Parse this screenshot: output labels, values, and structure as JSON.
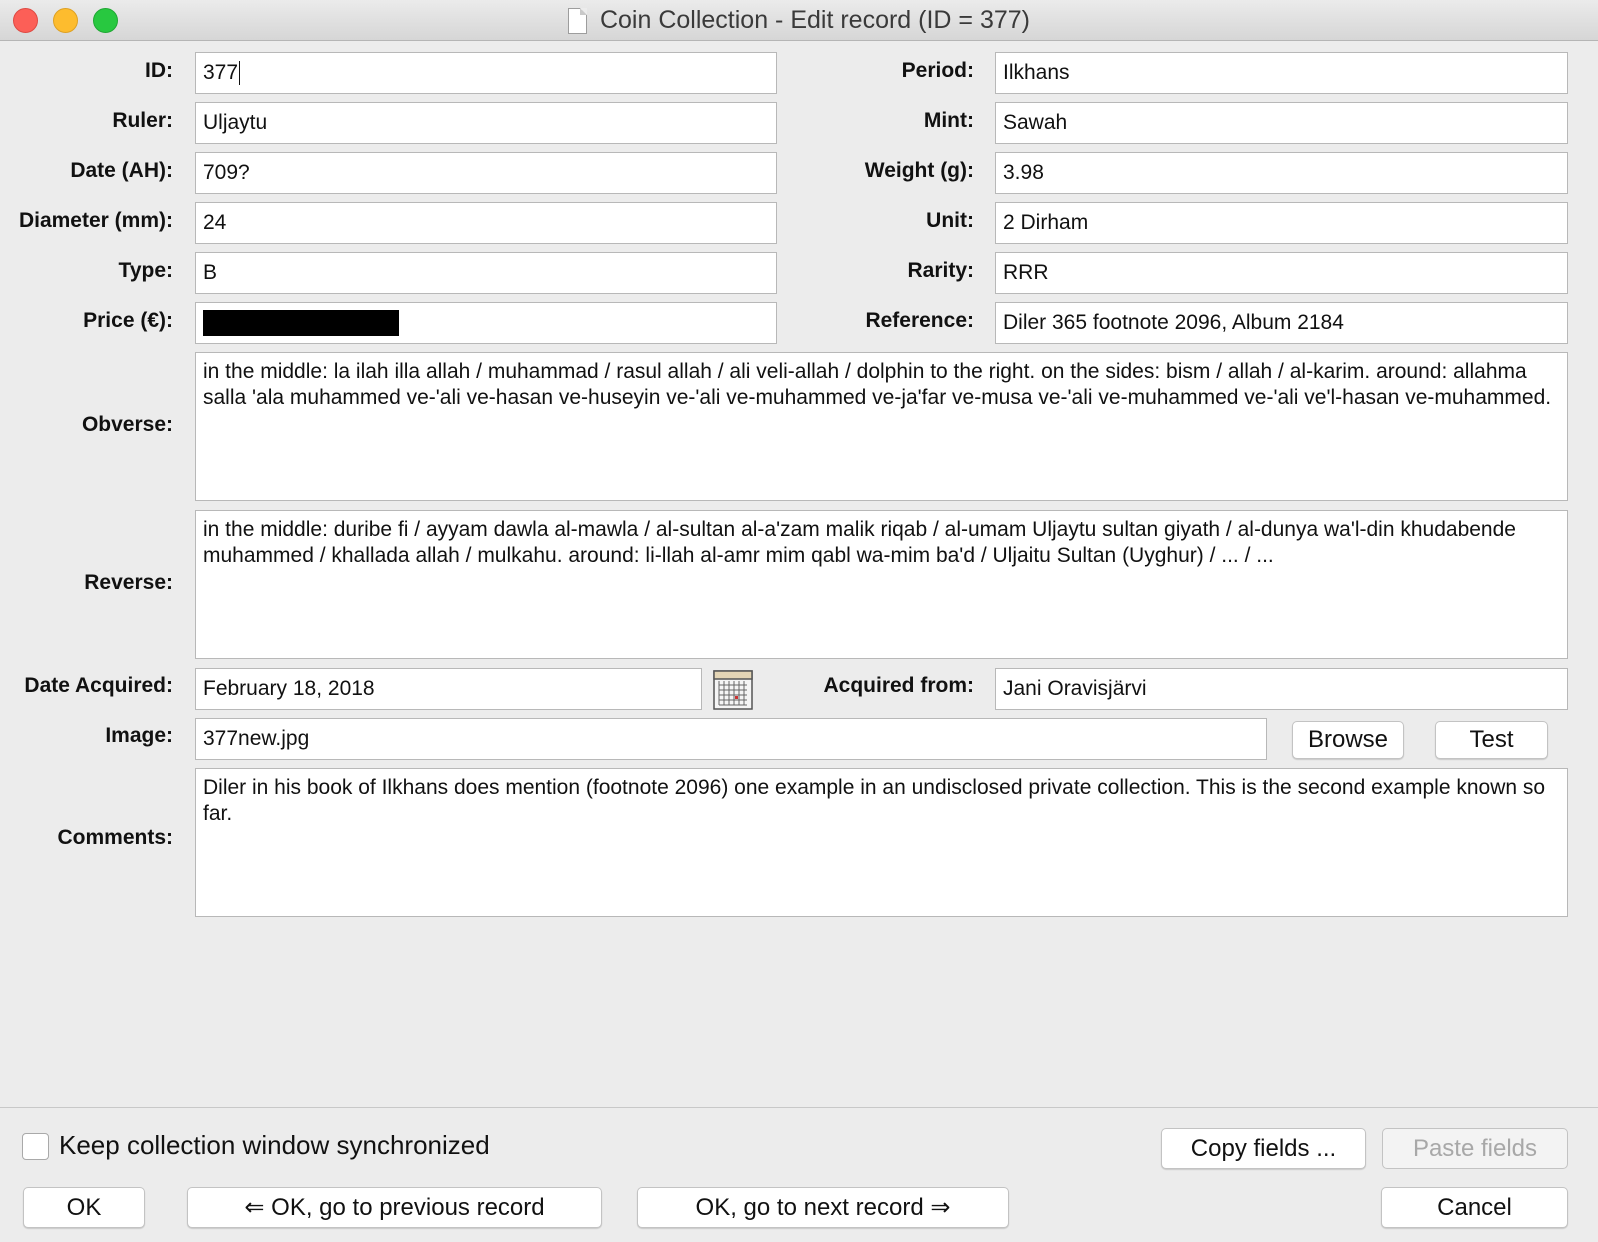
{
  "window": {
    "title": "Coin Collection - Edit record (ID = 377)"
  },
  "fields": {
    "id": {
      "label": "ID:",
      "value": "377"
    },
    "period": {
      "label": "Period:",
      "value": "Ilkhans"
    },
    "ruler": {
      "label": "Ruler:",
      "value": "Uljaytu"
    },
    "mint": {
      "label": "Mint:",
      "value": "Sawah"
    },
    "date_ah": {
      "label": "Date (AH):",
      "value": "709?"
    },
    "weight": {
      "label": "Weight (g):",
      "value": "3.98"
    },
    "diameter": {
      "label": "Diameter (mm):",
      "value": "24"
    },
    "unit": {
      "label": "Unit:",
      "value": "2 Dirham"
    },
    "type": {
      "label": "Type:",
      "value": "B"
    },
    "rarity": {
      "label": "Rarity:",
      "value": "RRR"
    },
    "price": {
      "label": "Price (€):"
    },
    "reference": {
      "label": "Reference:",
      "value": "Diler 365 footnote 2096, Album 2184"
    },
    "obverse": {
      "label": "Obverse:",
      "value": "in the middle: la ilah illa allah / muhammad / rasul allah / ali veli-allah / dolphin to the right. on the sides: bism / allah / al-karim. around: allahma salla 'ala muhammed ve-'ali ve-hasan ve-huseyin ve-'ali ve-muhammed ve-ja'far ve-musa ve-'ali ve-muhammed ve-'ali ve'l-hasan ve-muhammed."
    },
    "reverse": {
      "label": "Reverse:",
      "value": "in the middle: duribe fi / ayyam dawla al-mawla / al-sultan al-a'zam malik riqab / al-umam Uljaytu sultan giyath / al-dunya wa'l-din khudabende muhammed / khallada allah / mulkahu. around: li-llah al-amr mim qabl wa-mim ba'd / Uljaitu Sultan (Uyghur) / ... / ..."
    },
    "date_acquired": {
      "label": "Date Acquired:",
      "value": "February 18, 2018"
    },
    "acquired_from": {
      "label": "Acquired from:",
      "value": "Jani Oravisjärvi"
    },
    "image": {
      "label": "Image:",
      "value": "377new.jpg"
    },
    "comments": {
      "label": "Comments:",
      "value": "Diler in his book of Ilkhans does mention (footnote 2096) one example in an undisclosed private collection. This is the second example known so far."
    }
  },
  "buttons": {
    "browse": "Browse",
    "test": "Test",
    "copy_fields": "Copy fields ...",
    "paste_fields": "Paste fields",
    "ok": "OK",
    "ok_prev": "⇐ OK, go to previous record",
    "ok_next": "OK, go to next record ⇒",
    "cancel": "Cancel"
  },
  "sync_checkbox": {
    "label": "Keep collection window synchronized",
    "checked": false
  },
  "icons": {
    "calendar": "calendar-icon",
    "document": "document-icon"
  },
  "colors": {
    "close": "#fc5f57",
    "minimize": "#fdbc2e",
    "maximize": "#28c840"
  }
}
